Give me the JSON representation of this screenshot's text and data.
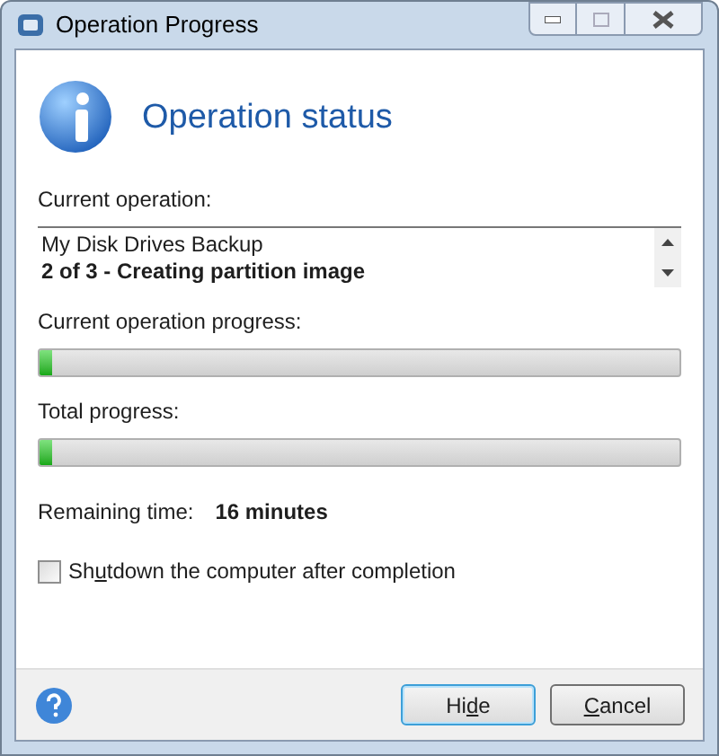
{
  "window": {
    "title": "Operation Progress"
  },
  "header": {
    "title": "Operation status"
  },
  "current_operation": {
    "label": "Current operation:",
    "lines": [
      {
        "text": "My Disk Drives Backup",
        "bold": false
      },
      {
        "text": "2 of 3 - Creating partition image",
        "bold": true
      }
    ]
  },
  "progress": [
    {
      "label": "Current operation progress:",
      "level": 0.02
    },
    {
      "label": "Total progress:",
      "level": 0.02
    }
  ],
  "remaining": {
    "label": "Remaining time:",
    "value": "16 minutes"
  },
  "shutdown_checkbox": {
    "label": [
      {
        "text": "Sh",
        "underlined": false
      },
      {
        "text": "u",
        "underlined": true
      },
      {
        "text": "tdown the computer after completion",
        "underlined": false
      }
    ],
    "checked": false
  },
  "buttons": [
    {
      "label": [
        {
          "text": "Hi",
          "underlined": false
        },
        {
          "text": "d",
          "underlined": true
        },
        {
          "text": "e",
          "underlined": false
        }
      ],
      "default": true
    },
    {
      "label": [
        {
          "text": "C",
          "underlined": true
        },
        {
          "text": "ancel",
          "underlined": false
        }
      ],
      "default": false
    }
  ]
}
